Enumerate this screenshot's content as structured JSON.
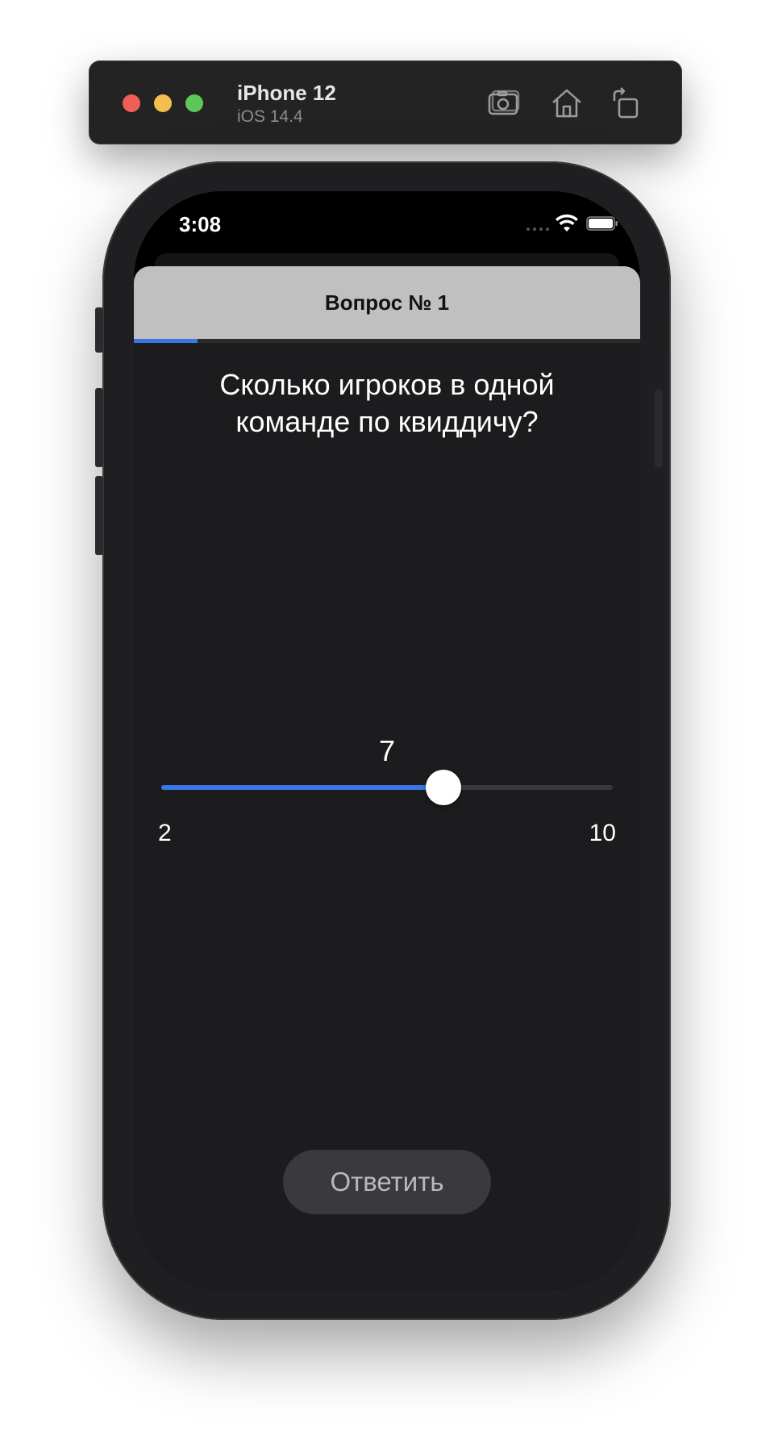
{
  "simulator": {
    "device_name": "iPhone 12",
    "os_version": "iOS 14.4",
    "toolbar_icons": [
      "screenshot-icon",
      "home-icon",
      "rotate-icon"
    ]
  },
  "status_bar": {
    "time": "3:08"
  },
  "quiz": {
    "nav_title": "Вопрос № 1",
    "progress_fraction": 0.125,
    "question": "Сколько игроков в одной команде по квиддичу?",
    "slider": {
      "value": "7",
      "min": "2",
      "max": "10"
    },
    "answer_button": "Ответить"
  },
  "colors": {
    "accent": "#3a76e6",
    "background": "#1c1c1e",
    "header": "#c0c0c0"
  }
}
